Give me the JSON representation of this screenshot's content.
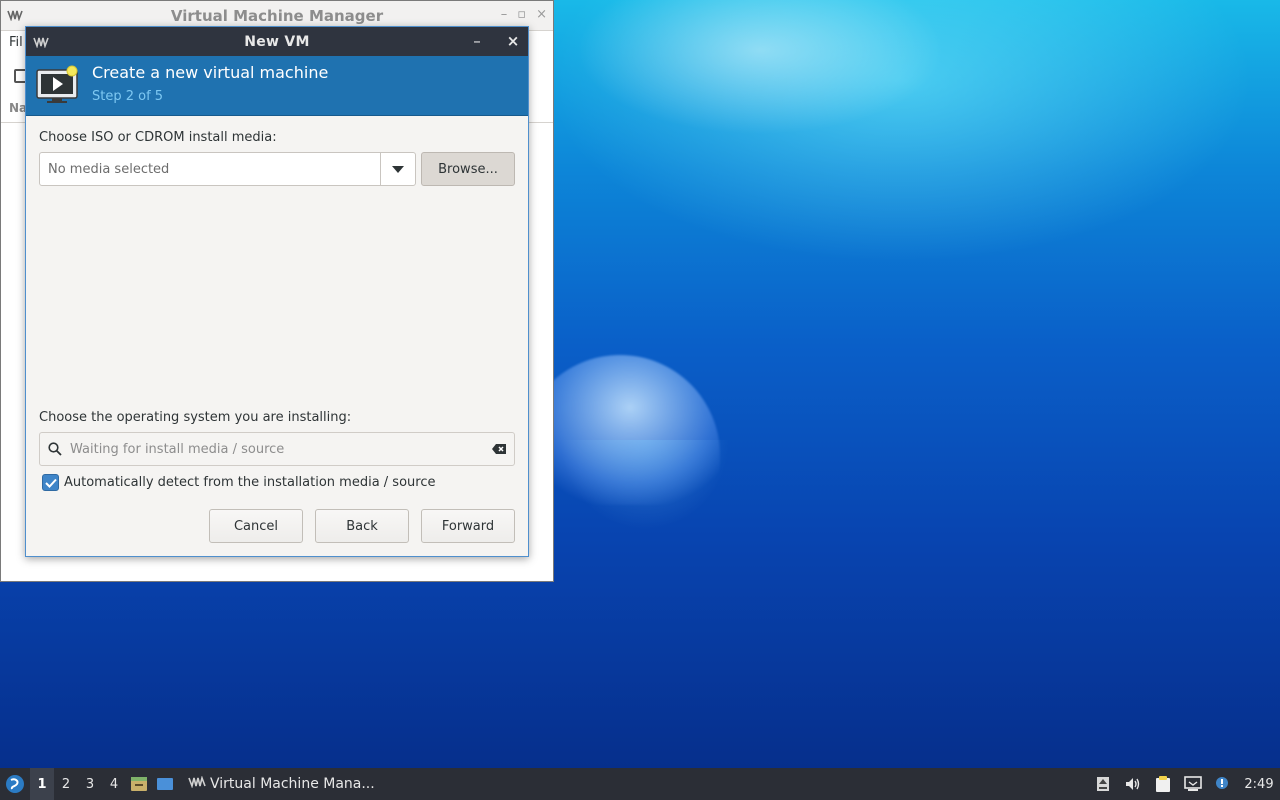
{
  "main_window": {
    "title": "Virtual Machine Manager",
    "menu_file": "Fil",
    "column_name": "Na"
  },
  "dialog": {
    "title": "New VM",
    "minimize_glyph": "–",
    "close_glyph": "×",
    "header": {
      "title": "Create a new virtual machine",
      "step": "Step 2 of 5"
    },
    "install_media": {
      "label": "Choose ISO or CDROM install media:",
      "placeholder": "No media selected",
      "browse_label": "Browse..."
    },
    "os": {
      "label": "Choose the operating system you are installing:",
      "placeholder": "Waiting for install media / source",
      "auto_detect_label": "Automatically detect from the installation media / source",
      "auto_detect_checked": true
    },
    "buttons": {
      "cancel": "Cancel",
      "back": "Back",
      "forward": "Forward"
    },
    "colors": {
      "header_bg": "#1f72b0",
      "titlebar_bg": "#2f343f",
      "checkbox": "#3f85c8"
    }
  },
  "taskbar": {
    "workspaces": [
      "1",
      "2",
      "3",
      "4"
    ],
    "active_workspace": "1",
    "task_label": "Virtual Machine Mana...",
    "clock": "2:49",
    "icons": [
      "start-menu-icon",
      "file-manager-icon",
      "show-desktop-icon",
      "virt-manager-icon",
      "update-icon",
      "volume-icon",
      "clipboard-icon",
      "network-icon",
      "notification-icon"
    ]
  }
}
